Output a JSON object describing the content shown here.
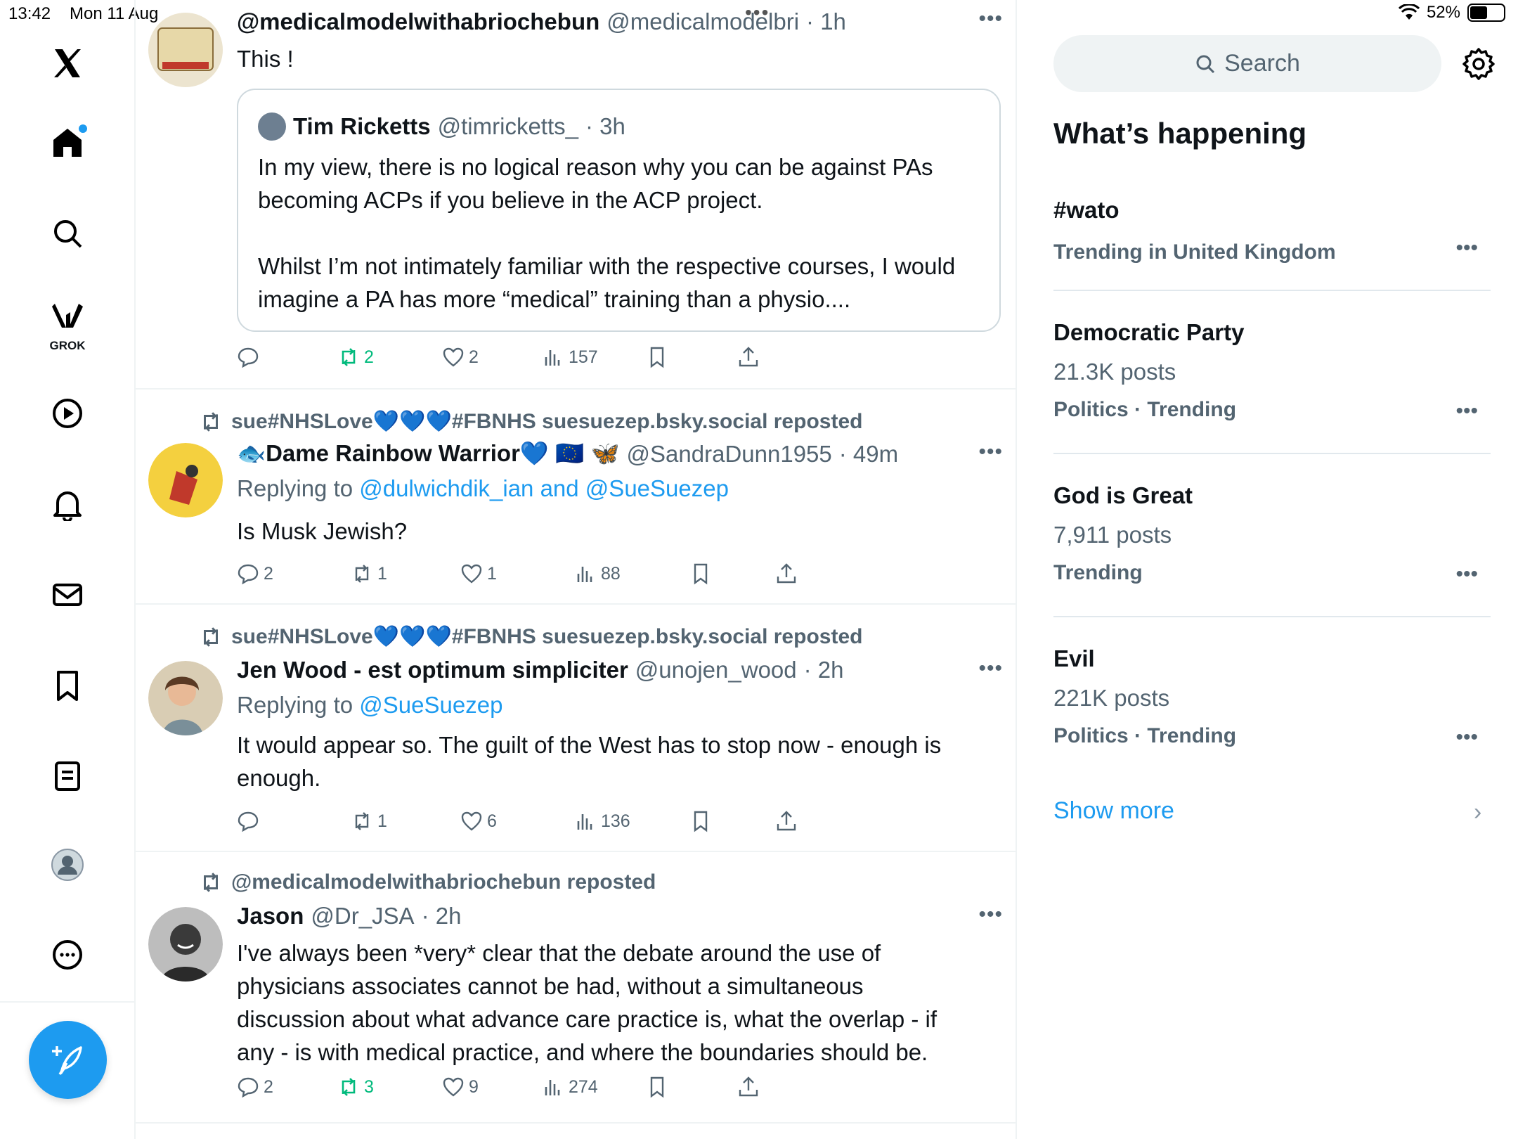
{
  "status_bar": {
    "time": "13:42",
    "date": "Mon 11 Aug",
    "battery": "52%",
    "battery_level": 0.52
  },
  "sidebar": {
    "grok_label": "GROK"
  },
  "tweets": [
    {
      "name": "@medicalmodelwithabriochebun",
      "handle": "@medicalmodelbri",
      "time": "· 1h",
      "body": "This !",
      "quote": {
        "name": "Tim Ricketts",
        "handle": "@timricketts_",
        "time": "· 3h",
        "body_1": "In my view, there is no logical reason why you can be against PAs becoming ACPs if you believe in the ACP project.",
        "body_2": "Whilst I’m not intimately familiar with the respective courses, I would imagine a PA has more “medical” training than a physio...."
      },
      "replies": "",
      "reposts": "2",
      "likes": "2",
      "views": "157"
    },
    {
      "repost_by": "sue#NHSLove💙💙💙#FBNHS suesuezep.bsky.social reposted",
      "name": "🐟Dame Rainbow Warrior💙 🇪🇺 🦋",
      "handle": "@SandraDunn1955",
      "time": "· 49m",
      "reply_prefix": "Replying to",
      "reply_to": "@dulwichdik_ian and @SueSuezep",
      "body": "Is Musk Jewish?",
      "replies": "2",
      "reposts": "1",
      "likes": "1",
      "views": "88"
    },
    {
      "repost_by": "sue#NHSLove💙💙💙#FBNHS suesuezep.bsky.social reposted",
      "name": "Jen Wood - est optimum simpliciter",
      "handle": "@unojen_wood",
      "time": "· 2h",
      "reply_prefix": "Replying to",
      "reply_to": "@SueSuezep",
      "body": "It would appear so. The guilt of the West has to stop now - enough is enough.",
      "replies": "",
      "reposts": "1",
      "likes": "6",
      "views": "136"
    },
    {
      "repost_by": "@medicalmodelwithabriochebun reposted",
      "name": "Jason",
      "handle": "@Dr_JSA",
      "time": "· 2h",
      "body": "I've always been *very* clear that the debate around the use of physicians associates cannot be had, without a simultaneous discussion about what advance care practice is, what the overlap - if any - is with medical practice, and where the boundaries should be.",
      "replies": "2",
      "reposts": "3",
      "likes": "9",
      "views": "274"
    }
  ],
  "right": {
    "search_placeholder": "Search",
    "title": "What’s happening",
    "trends": [
      {
        "name": "#wato",
        "count": "",
        "meta": "Trending in United Kingdom"
      },
      {
        "name": "Democratic Party",
        "count": "21.3K posts",
        "meta": "Politics · Trending"
      },
      {
        "name": "God is Great",
        "count": "7,911 posts",
        "meta": "Trending"
      },
      {
        "name": "Evil",
        "count": "221K posts",
        "meta": "Politics · Trending"
      }
    ],
    "show_more": "Show more"
  },
  "colors": {
    "accent": "#1d9bf0",
    "repost_green": "#00ba7c",
    "muted": "#536471",
    "text": "#0f1419"
  },
  "icons": [
    "x-logo-icon",
    "home-icon",
    "search-icon",
    "grok-icon",
    "video-icon",
    "bell-icon",
    "mail-icon",
    "bookmark-icon",
    "lists-icon",
    "profile-icon",
    "more-icon",
    "compose-icon",
    "reply-icon",
    "repost-icon",
    "like-icon",
    "views-icon",
    "share-icon",
    "gear-icon",
    "chevron-right-icon"
  ]
}
